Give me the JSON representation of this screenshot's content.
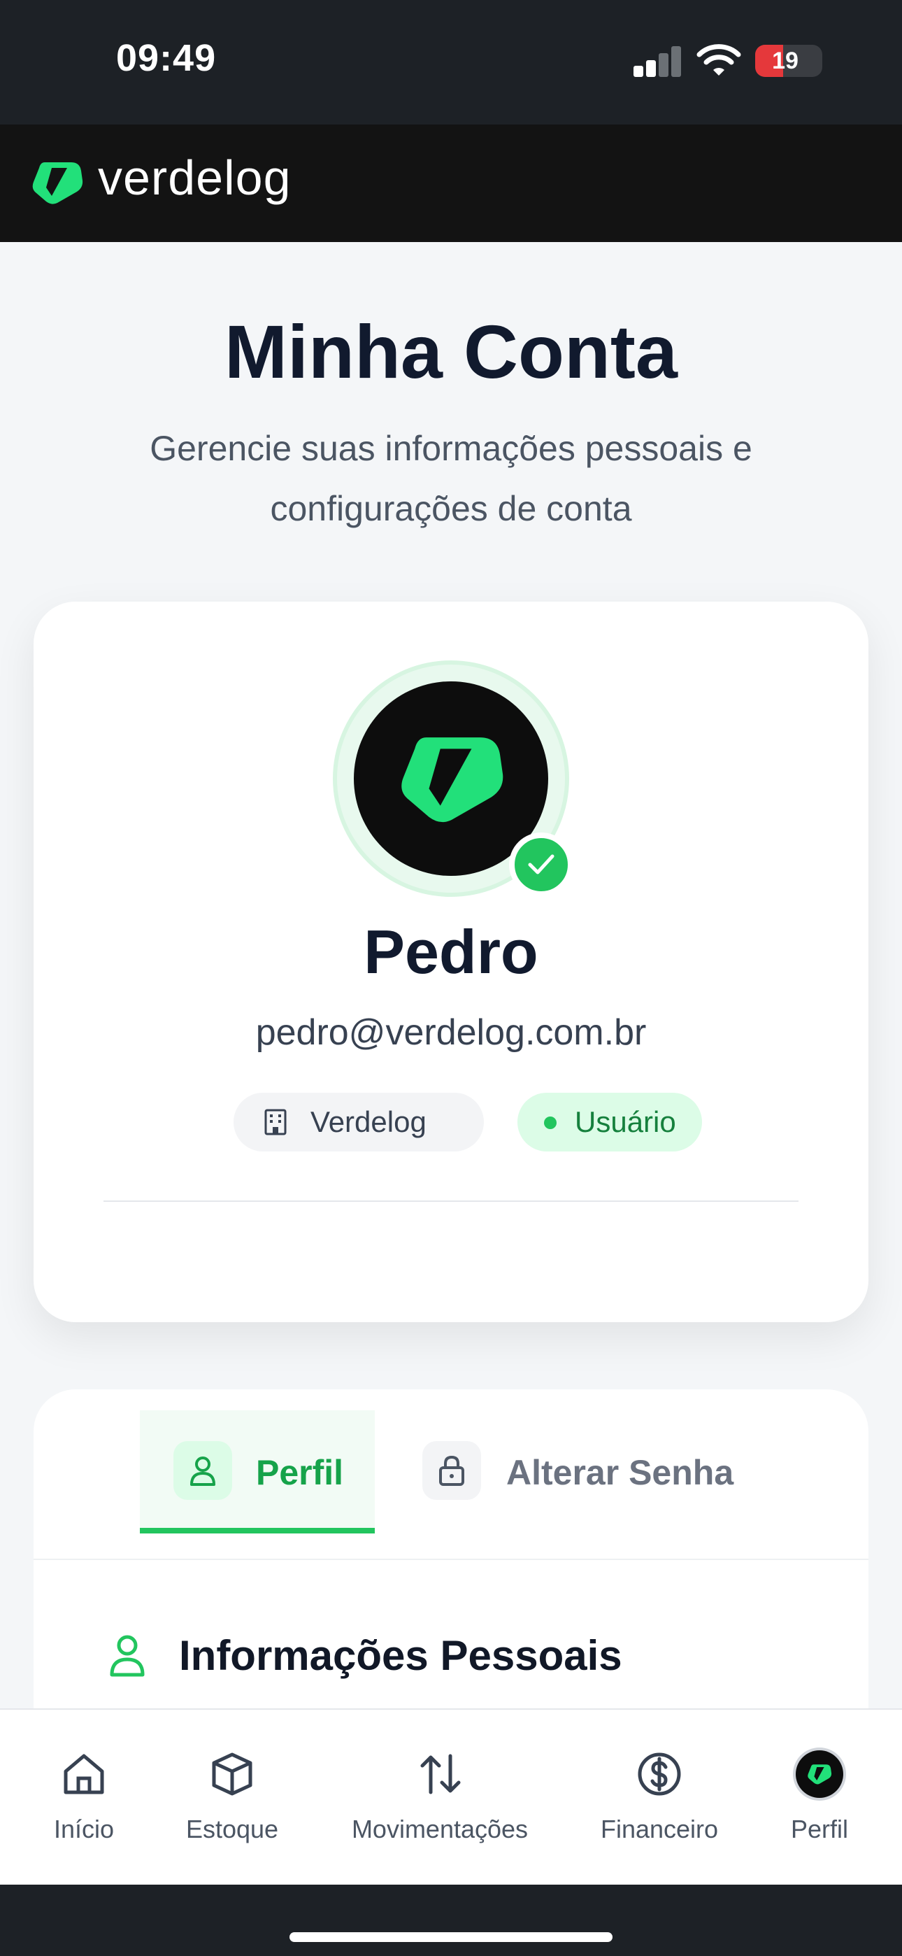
{
  "status_bar": {
    "time": "09:49",
    "battery": "19",
    "battery_level_percent": 19,
    "icons": [
      "signal-icon",
      "wifi-icon",
      "battery-icon"
    ]
  },
  "header": {
    "brand": "verdelog",
    "logo_icon": "verdelog-logo-icon"
  },
  "page": {
    "title": "Minha Conta",
    "subtitle": "Gerencie suas informações pessoais e configurações de conta"
  },
  "profile": {
    "name": "Pedro",
    "email": "pedro@verdelog.com.br",
    "company": "Verdelog",
    "role": "Usuário",
    "verified_icon": "check-icon"
  },
  "tabs": [
    {
      "label": "Perfil",
      "icon": "user-icon",
      "active": true
    },
    {
      "label": "Alterar Senha",
      "icon": "lock-icon",
      "active": false
    }
  ],
  "section": {
    "title": "Informações Pessoais",
    "icon": "user-icon"
  },
  "bottom_nav": [
    {
      "label": "Início",
      "icon": "home-icon"
    },
    {
      "label": "Estoque",
      "icon": "box-icon"
    },
    {
      "label": "Movimentações",
      "icon": "arrows-updown-icon"
    },
    {
      "label": "Financeiro",
      "icon": "dollar-icon"
    },
    {
      "label": "Perfil",
      "icon": "avatar-icon",
      "active": true
    }
  ],
  "colors": {
    "brand_green": "#22c55e",
    "brand_green_dark": "#16a34a",
    "header_bg": "#131313",
    "title": "#111a2e"
  }
}
